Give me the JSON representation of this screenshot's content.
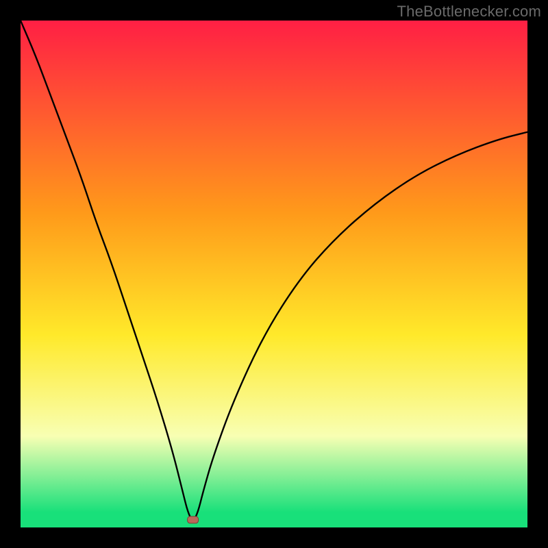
{
  "watermark": "TheBottlenecker.com",
  "colors": {
    "red": "#ff1f44",
    "orange": "#ff9a1a",
    "yellow": "#ffe92a",
    "pale": "#f8ffb3",
    "green": "#18e07a",
    "black": "#000000",
    "marker_fill": "#b86a5a",
    "marker_stroke": "#7a4034"
  },
  "chart_data": {
    "type": "line",
    "title": "",
    "xlabel": "",
    "ylabel": "",
    "xlim": [
      0,
      100
    ],
    "ylim": [
      0,
      100
    ],
    "notch_x": 34,
    "marker_y": 1.5,
    "gradient_stops": [
      {
        "offset": 0.0,
        "color_key": "red"
      },
      {
        "offset": 0.38,
        "color_key": "orange"
      },
      {
        "offset": 0.62,
        "color_key": "yellow"
      },
      {
        "offset": 0.82,
        "color_key": "pale"
      },
      {
        "offset": 0.97,
        "color_key": "green"
      },
      {
        "offset": 1.0,
        "color_key": "green"
      }
    ],
    "series": [
      {
        "name": "bottleneck-curve",
        "x": [
          0,
          3,
          6,
          9,
          12,
          15,
          18,
          21,
          24,
          27,
          30,
          32,
          33,
          34,
          35,
          36,
          38,
          42,
          48,
          55,
          62,
          70,
          78,
          86,
          94,
          100
        ],
        "y": [
          100,
          93,
          85,
          77,
          69,
          60,
          52,
          43,
          34,
          25,
          15,
          7,
          3,
          1,
          3,
          7,
          14,
          25,
          38,
          49,
          57,
          64,
          69.5,
          73.5,
          76.5,
          78
        ]
      }
    ]
  }
}
